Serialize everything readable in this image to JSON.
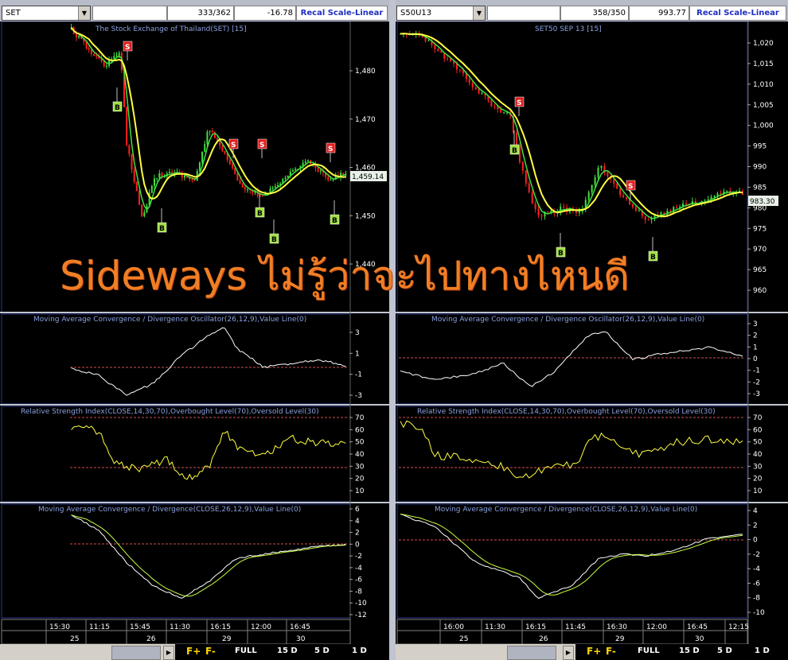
{
  "left": {
    "symbol": "SET",
    "count": "333/362",
    "change": "-16.78",
    "recal": "Recal Scale-Linear",
    "title": "The Stock Exchange of Thailand(SET) [15]",
    "price_label": "1,459.14",
    "price_ticks": [
      "1,480",
      "1,470",
      "1,460",
      "1,450",
      "1,440"
    ],
    "macd_osc_title": "Moving Average Convergence / Divergence Oscillator(26,12,9),Value Line(0)",
    "macd_osc_ticks": [
      "3",
      "1",
      "-1",
      "-3"
    ],
    "rsi_title": "Relative Strength Index(CLOSE,14,30,70),Overbought Level(70),Oversold Level(30)",
    "rsi_ticks": [
      "70",
      "60",
      "50",
      "40",
      "30",
      "20",
      "10"
    ],
    "macd_title": "Moving Average Convergence / Divergence(CLOSE,26,12,9),Value Line(0)",
    "macd_ticks": [
      "6",
      "4",
      "2",
      "0",
      "-2",
      "-4",
      "-6",
      "-8",
      "-10",
      "-12"
    ],
    "time_labels": [
      "15:30",
      "11:15",
      "15:45",
      "11:30",
      "16:15",
      "12:00",
      "16:45"
    ],
    "day_labels": [
      "25",
      "26",
      "29",
      "30"
    ]
  },
  "right": {
    "symbol": "S50U13",
    "count": "358/350",
    "change": "993.77",
    "recal": "Recal Scale-Linear",
    "title": "SET50 SEP 13  [15]",
    "price_label": "983.30",
    "price_ticks": [
      "1,020",
      "1,015",
      "1,010",
      "1,005",
      "1,000",
      "995",
      "990",
      "985",
      "980",
      "975",
      "970",
      "965",
      "960"
    ],
    "macd_osc_title": "Moving Average Convergence / Divergence Oscillator(26,12,9),Value Line(0)",
    "macd_osc_ticks": [
      "3",
      "2",
      "1",
      "0",
      "-1",
      "-2",
      "-3"
    ],
    "rsi_title": "Relative Strength Index(CLOSE,14,30,70),Overbought Level(70),Oversold Level(30)",
    "rsi_ticks": [
      "70",
      "60",
      "50",
      "40",
      "30",
      "20",
      "10"
    ],
    "macd_title": "Moving Average Convergence / Divergence(CLOSE,26,12,9),Value Line(0)",
    "macd_ticks": [
      "4",
      "2",
      "0",
      "-2",
      "-4",
      "-6",
      "-8",
      "-10"
    ],
    "time_labels": [
      "16:00",
      "11:30",
      "16:15",
      "11:45",
      "16:30",
      "12:00",
      "16:45",
      "12:15"
    ],
    "day_labels": [
      "25",
      "26",
      "29",
      "30"
    ]
  },
  "overlay_text": "Sideways ไม่รู้ว่าจะไปทางไหนดี",
  "signals": {
    "buy": "B",
    "sell": "S"
  },
  "toolbar": {
    "f_plus": "F+",
    "f_minus": "F-",
    "full": "FULL",
    "d15": "15 D",
    "d5": "5 D",
    "d1": "1 D"
  },
  "colors": {
    "price_ma_fast": "#ffff40",
    "price_ma_slow": "#40e040",
    "candle_up": "#40e040",
    "candle_down": "#ff2020",
    "buy": "#a0e040",
    "sell": "#e02020",
    "overlay": "#f07f25"
  }
}
